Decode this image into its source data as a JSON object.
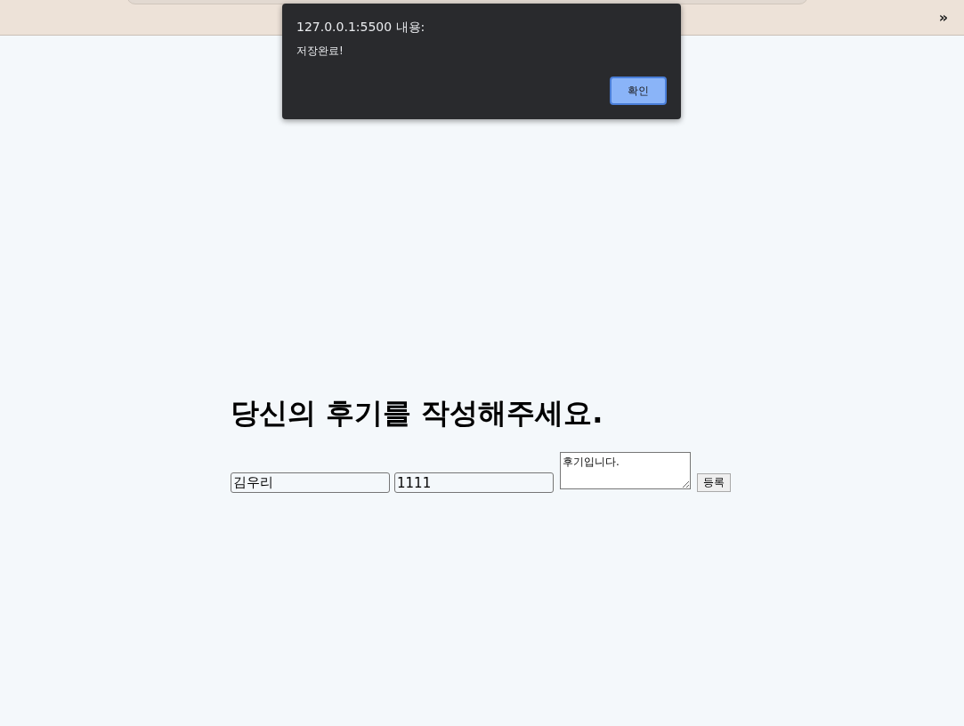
{
  "toolbar": {
    "overflow": "»"
  },
  "alert": {
    "origin": "127.0.0.1:5500 내용:",
    "message": "저장완료!",
    "ok_button": "확인"
  },
  "form": {
    "heading": "당신의 후기를 작성해주세요.",
    "name_value": "김우리",
    "password_value": "1111",
    "review_value": "후기입니다.",
    "submit_button": "등록"
  }
}
